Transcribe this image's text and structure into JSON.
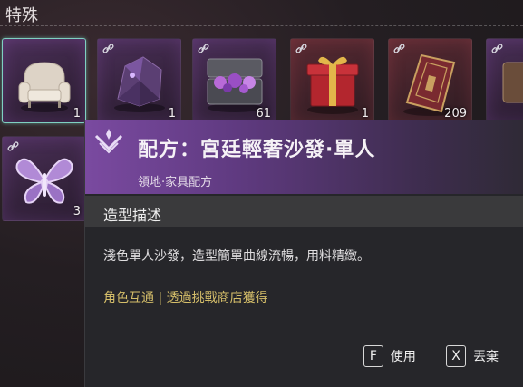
{
  "section": {
    "title": "特殊"
  },
  "inventory": [
    {
      "name": "sofa",
      "qty": "1",
      "selected": true,
      "linked": false,
      "icon": "sofa-icon"
    },
    {
      "name": "crystal-ore",
      "qty": "1",
      "linked": true,
      "icon": "crystal-icon"
    },
    {
      "name": "gem-chest",
      "qty": "61",
      "linked": true,
      "icon": "chest-icon"
    },
    {
      "name": "gift-box",
      "qty": "1",
      "linked": true,
      "icon": "gift-icon"
    },
    {
      "name": "tome",
      "qty": "209",
      "linked": true,
      "icon": "book-icon"
    },
    {
      "name": "partial",
      "qty": "",
      "linked": true,
      "icon": "item-icon"
    },
    {
      "name": "butterfly",
      "qty": "3",
      "linked": true,
      "icon": "butterfly-icon"
    }
  ],
  "tooltip": {
    "title": "配方：宮廷輕奢沙發·單人",
    "subtitle": "領地·家具配方",
    "section_label": "造型描述",
    "description": "淺色單人沙發，造型簡單曲線流暢，用料精緻。",
    "source": "角色互通 | 透過挑戰商店獲得",
    "actions": [
      {
        "key": "F",
        "label": "使用"
      },
      {
        "key": "X",
        "label": "丟棄"
      }
    ]
  },
  "colors": {
    "accent_gold": "#d6bf6a",
    "rarity_purple": "#7a4aa0",
    "selected_border": "#7fd0c2"
  }
}
